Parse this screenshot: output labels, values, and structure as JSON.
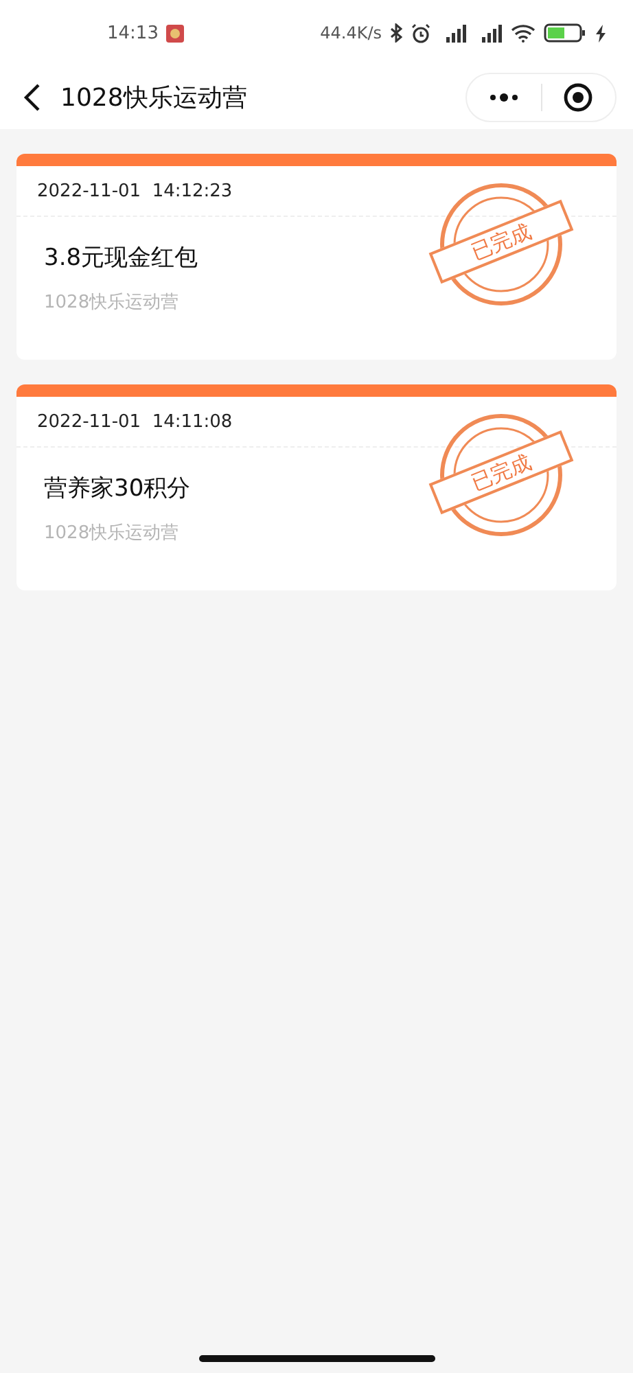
{
  "status_bar": {
    "time": "14:13",
    "speed": "44.4K/s"
  },
  "nav": {
    "title": "1028快乐运动营"
  },
  "records": [
    {
      "time": "2022-11-01  14:12:23",
      "title": "3.8元现金红包",
      "source": "1028快乐运动营",
      "stamp": "已完成"
    },
    {
      "time": "2022-11-01  14:11:08",
      "title": "营养家30积分",
      "source": "1028快乐运动营",
      "stamp": "已完成"
    }
  ]
}
